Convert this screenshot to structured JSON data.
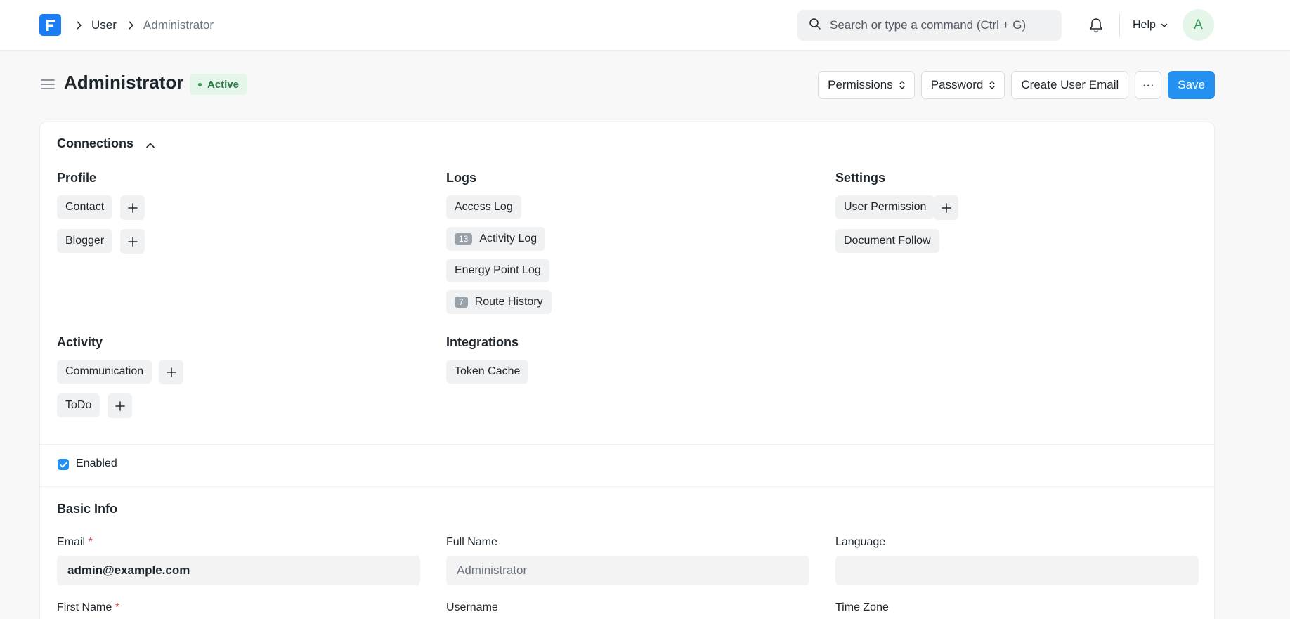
{
  "navbar": {
    "breadcrumb": [
      "User",
      "Administrator"
    ],
    "search_placeholder": "Search or type a command (Ctrl + G)",
    "help_label": "Help",
    "avatar_initial": "A"
  },
  "page_head": {
    "title": "Administrator",
    "status": "Active",
    "actions": {
      "permissions": "Permissions",
      "password": "Password",
      "create_user_email": "Create User Email",
      "more": "···",
      "save": "Save"
    }
  },
  "connections": {
    "title": "Connections",
    "groups": {
      "profile": {
        "title": "Profile",
        "items": [
          "Contact",
          "Blogger"
        ]
      },
      "logs": {
        "title": "Logs",
        "items": [
          {
            "label": "Access Log",
            "count": ""
          },
          {
            "label": "Activity Log",
            "count": "13"
          },
          {
            "label": "Energy Point Log",
            "count": ""
          },
          {
            "label": "Route History",
            "count": "7"
          }
        ]
      },
      "settings": {
        "title": "Settings",
        "items": [
          "User Permission",
          "Document Follow"
        ]
      },
      "activity": {
        "title": "Activity",
        "items": [
          "Communication",
          "ToDo"
        ]
      },
      "integrations": {
        "title": "Integrations",
        "items": [
          "Token Cache"
        ]
      }
    }
  },
  "enabled_label": "Enabled",
  "basic_info": {
    "title": "Basic Info",
    "email_label": "Email",
    "email_value": "admin@example.com",
    "full_name_label": "Full Name",
    "full_name_value": "Administrator",
    "language_label": "Language",
    "language_value": "",
    "first_name_label": "First Name",
    "username_label": "Username",
    "time_zone_label": "Time Zone",
    "required_mark": "*"
  },
  "colors": {
    "primary": "#2490ef",
    "logo": "#1b7cf3",
    "status_bg": "#e4f5e9",
    "status_text": "#2b7a48"
  }
}
